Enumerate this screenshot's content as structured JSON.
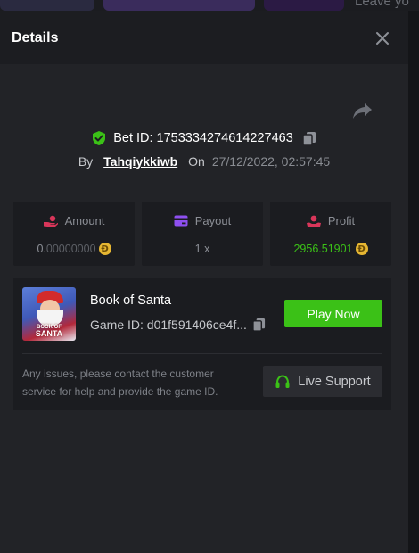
{
  "background": {
    "peek_text": "Leave yo"
  },
  "modal": {
    "title": "Details",
    "bet_id_label": "Bet ID:",
    "bet_id": "1753334274614227463",
    "by_label": "By",
    "username": "Tahqiykkiwb",
    "on_label": "On",
    "datetime": "27/12/2022, 02:57:45"
  },
  "stats": {
    "amount": {
      "label": "Amount",
      "value_dim": "0.",
      "value_rest": "00000000",
      "icon": "hand-coin-icon",
      "icon_color": "#d9365a"
    },
    "payout": {
      "label": "Payout",
      "value": "1 x",
      "icon": "card-icon",
      "icon_color": "#8e4ff0"
    },
    "profit": {
      "label": "Profit",
      "value": "2956.51901",
      "icon": "hand-coin-icon",
      "icon_color": "#d9365a",
      "value_color": "#3bc117"
    }
  },
  "coin_symbol": "Đ",
  "game": {
    "thumb_small": "BOOK OF",
    "thumb_big": "SANTA",
    "name": "Book of Santa",
    "game_id": "Game ID: d01f591406ce4f...",
    "play_label": "Play Now",
    "note": "Any issues, please contact the customer service for help and provide the game ID.",
    "support_label": "Live Support"
  },
  "colors": {
    "accent_green": "#3bc117",
    "panel": "#1b1c20",
    "modal": "#222327"
  }
}
